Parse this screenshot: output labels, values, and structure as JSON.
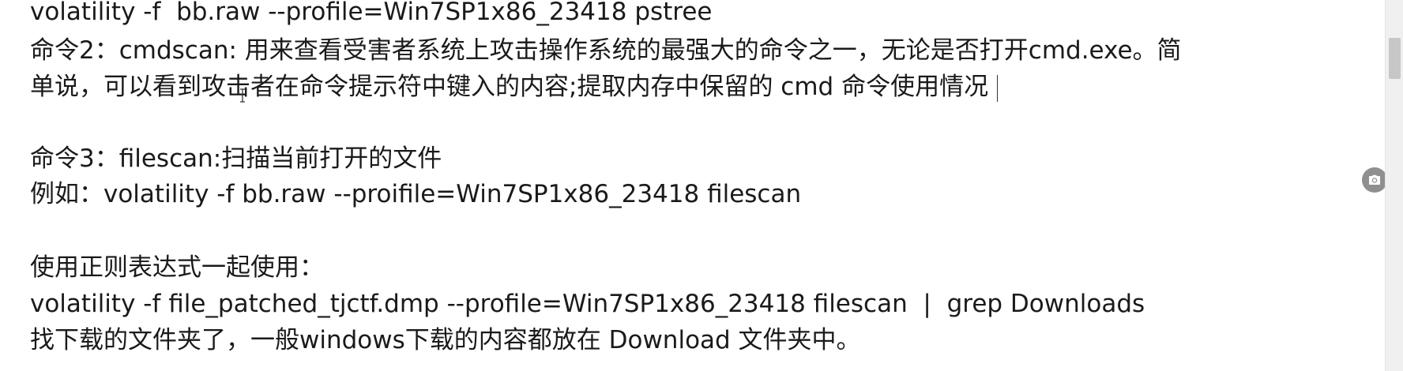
{
  "document": {
    "lines": [
      "volatility -f  bb.raw --profile=Win7SP1x86_23418 pstree",
      "命令2：cmdscan: 用来查看受害者系统上攻击操作系统的最强大的命令之一，无论是否打开cmd.exe。简",
      "单说，可以看到攻击者在命令提示符中键入的内容;提取内存中保留的 cmd 命令使用情况",
      "命令3：filescan:扫描当前打开的文件",
      "例如：volatility -f bb.raw --proifile=Win7SP1x86_23418 filescan",
      "使用正则表达式一起使用：",
      "volatility -f file_patched_tjctf.dmp --profile=Win7SP1x86_23418 filescan  |  grep Downloads",
      "找下载的文件夹了，一般windows下载的内容都放在 Download 文件夹中。"
    ]
  },
  "ui": {
    "camera_icon": "camera-icon",
    "cursor_icon": "text-cursor-icon"
  }
}
